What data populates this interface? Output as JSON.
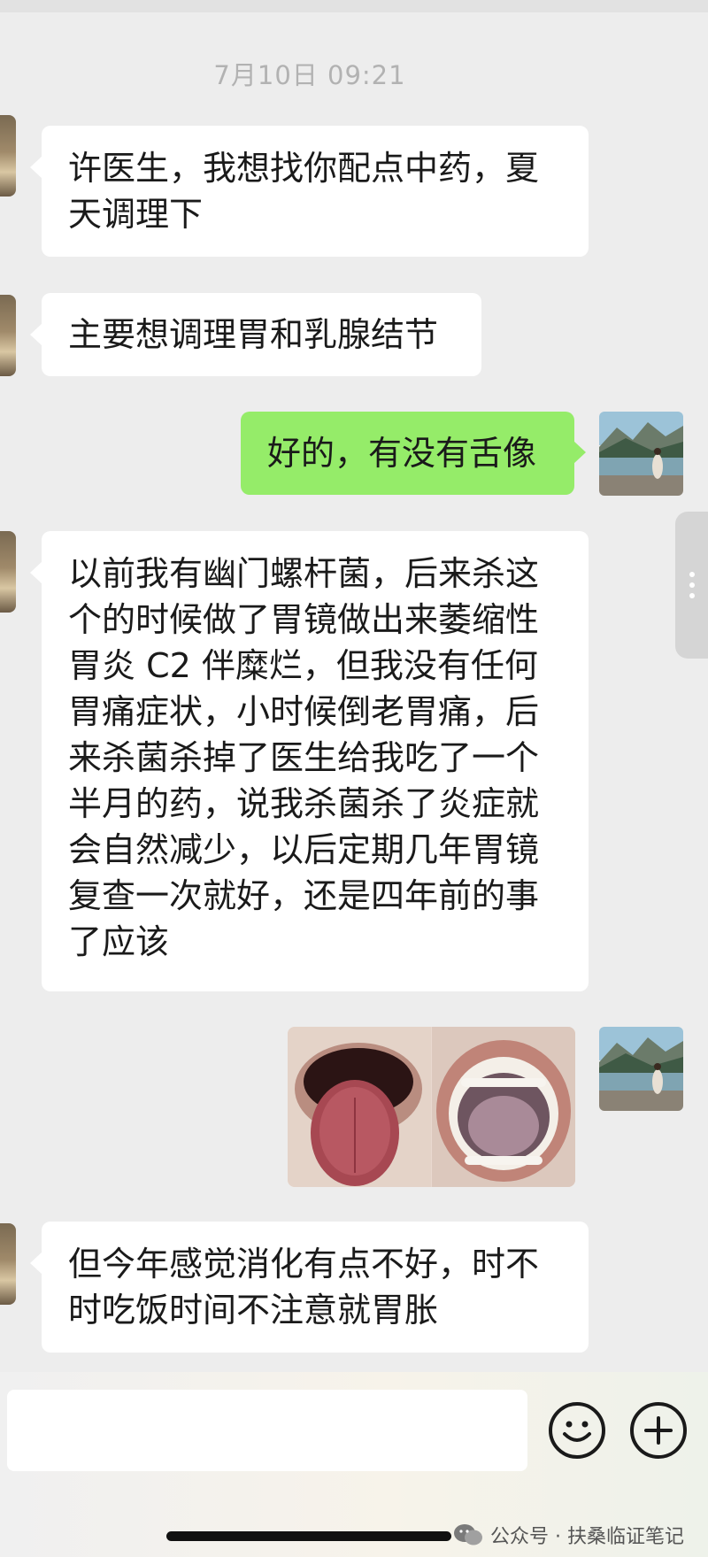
{
  "chat": {
    "timestamp": "7月10日 09:21",
    "messages": [
      {
        "side": "left",
        "lines": [
          "许医生，我想找你配点中药，夏",
          "天调理下"
        ]
      },
      {
        "side": "left",
        "lines": [
          "主要想调理胃和乳腺结节"
        ]
      },
      {
        "side": "right",
        "lines": [
          "好的，有没有舌像"
        ]
      },
      {
        "side": "left",
        "lines": [
          "以前我有幽门螺杆菌，后来杀这",
          "个的时候做了胃镜做出来萎缩性",
          "胃炎 C2 伴糜烂，但我没有任何",
          "胃痛症状，小时候倒老胃痛，后",
          "来杀菌杀掉了医生给我吃了一个",
          "半月的药，说我杀菌杀了炎症就",
          "会自然减少，以后定期几年胃镜",
          "复查一次就好，还是四年前的事",
          "了应该"
        ]
      },
      {
        "side": "right",
        "type": "image",
        "alt": "tongue-photos"
      },
      {
        "side": "left",
        "lines": [
          "但今年感觉消化有点不好，时不",
          "时吃饭时间不注意就胃胀"
        ]
      }
    ]
  },
  "icons": {
    "emoji": "emoji-icon",
    "add": "plus-icon",
    "wechat": "wechat-logo-icon"
  },
  "watermark": {
    "text": "公众号 · 扶桑临证笔记"
  },
  "colors": {
    "background": "#ededed",
    "bubble_left": "#ffffff",
    "bubble_right": "#95ec69",
    "timestamp": "#b2b2b2"
  }
}
